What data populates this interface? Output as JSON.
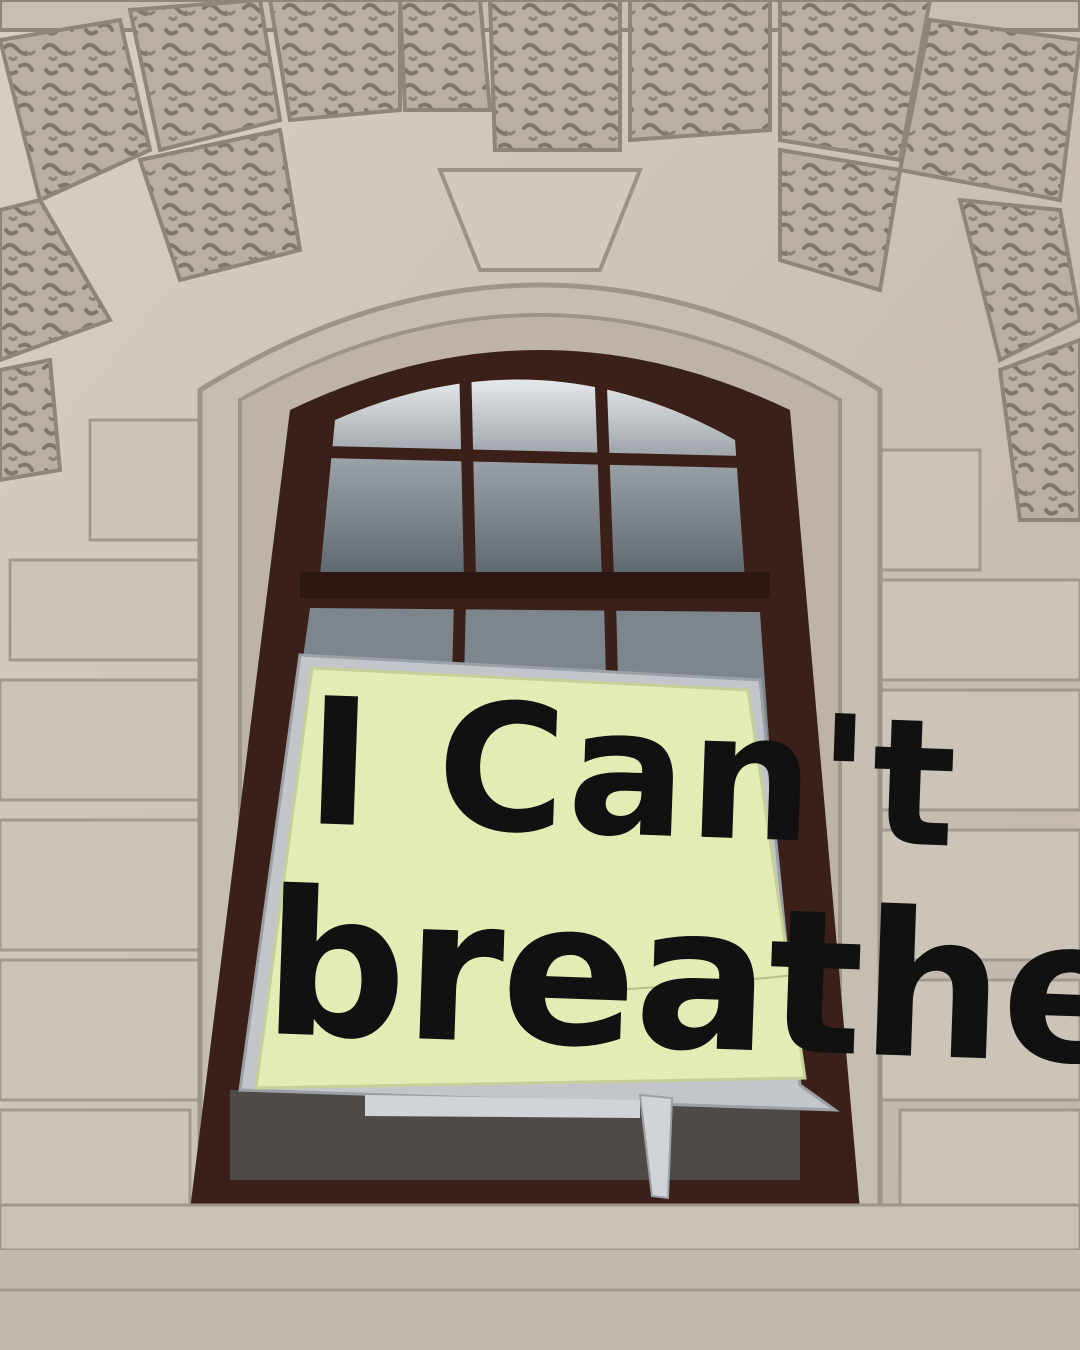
{
  "sign": {
    "line1": "I Can't",
    "line2": "breathe"
  },
  "colors": {
    "stone": "#cfc6bb",
    "stone_dark": "#a79d92",
    "window_frame": "#3a2019",
    "glass": "#8c949b",
    "paper": "#e2ecb4",
    "tape": "#c2c6cb",
    "paint": "#111111"
  }
}
